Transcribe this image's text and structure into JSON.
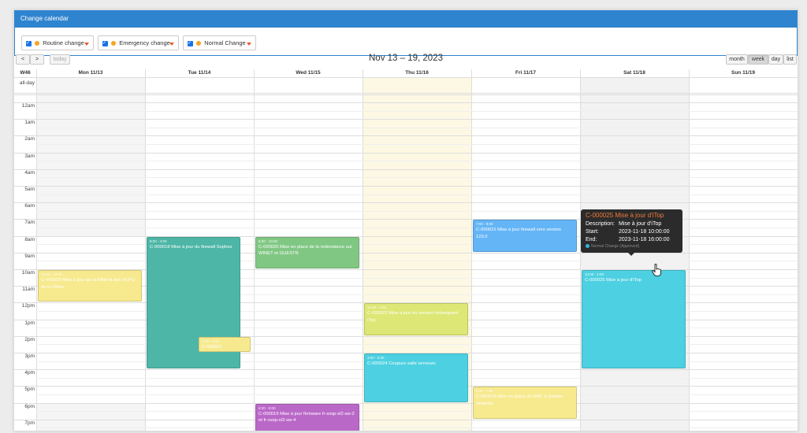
{
  "header": {
    "title": "Change calendar"
  },
  "filters": [
    {
      "label": "Routine change"
    },
    {
      "label": "Emergency change"
    },
    {
      "label": "Normal Change"
    }
  ],
  "toolbar": {
    "prev": "<",
    "next": ">",
    "today": "today",
    "title": "Nov 13 – 19, 2023",
    "views": [
      "month",
      "week",
      "day",
      "list"
    ],
    "active_view": "week"
  },
  "grid": {
    "week_label": "W46",
    "allday_label": "all-day",
    "days": [
      "Mon 11/13",
      "Tue 11/14",
      "Wed 11/15",
      "Thu 11/16",
      "Fri 11/17",
      "Sat 11/18",
      "Sun 11/19"
    ],
    "hours": [
      "12am",
      "1am",
      "2am",
      "3am",
      "4am",
      "5am",
      "6am",
      "7am",
      "8am",
      "9am",
      "10am",
      "11am",
      "12pm",
      "1pm",
      "2pm",
      "3pm",
      "4pm",
      "5pm",
      "6pm",
      "7pm"
    ]
  },
  "events": [
    {
      "time": "10:00 - 12:00",
      "title": "C-000023 Mise à jour de la RAM et des VCPU de la VMex",
      "color": "#f7e98e"
    },
    {
      "time": "8:00 - 4:00",
      "title": "C-000018 Mise à jour du firewall Sophos",
      "color": "#4db6a6"
    },
    {
      "time": "2:00 - 3:00",
      "title": "C-000021",
      "color": "#f7e98e"
    },
    {
      "time": "8:00 - 10:00",
      "title": "C-000020 Mise en place de la redondance sur WINET et GUESTR",
      "color": "#81c784"
    },
    {
      "time": "6:00 - 8:00",
      "title": "C-000019 Mise à jour firmware fr-sssp-sl2-sw-2 et fr-sssp-sl2-sw-4",
      "color": "#ba68c8"
    },
    {
      "time": "12:00 - 2:00",
      "title": "C-000022 Mise à jour du serveur hébergeant iTop",
      "color": "#dce775"
    },
    {
      "time": "3:00 - 6:00",
      "title": "C-000024 Coupure salle serveurs",
      "color": "#4dd0e1"
    },
    {
      "time": "7:00 - 9:00",
      "title": "C-000015 Mise à jour firewall vers version 123.0",
      "color": "#64b5f6"
    },
    {
      "time": "5:00 - 7:00",
      "title": "C-000016 Mise en place du NAC à Sophia-Antipolis",
      "color": "#f7e98e"
    },
    {
      "time": "10:00 - 4:00",
      "title": "C-000025 Mise à jour d'iTop",
      "color": "#4dd0e1"
    }
  ],
  "tooltip": {
    "title": "C-000025 Mise à jour d'iTop",
    "desc_label": "Description:",
    "desc_value": "Mise à jour d'iTop",
    "start_label": "Start:",
    "start_value": "2023-11-18 10:00:00",
    "end_label": "End:",
    "end_value": "2023-11-18 16:00:00",
    "status": "Normal Change (Approved)"
  }
}
